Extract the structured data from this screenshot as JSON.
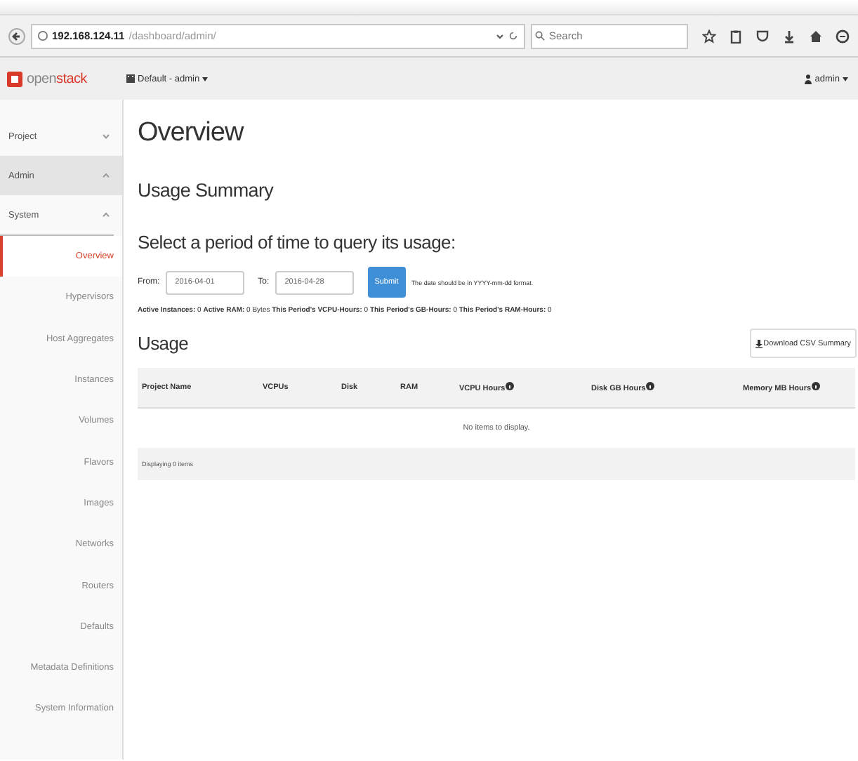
{
  "browser": {
    "url_host": "192.168.124.11",
    "url_path": "/dashboard/admin/",
    "search": {
      "placeholder": "Search"
    }
  },
  "header": {
    "logo_left": "open",
    "logo_right": "stack",
    "project_menu": "Default - admin",
    "user_menu": "admin"
  },
  "sidebar": {
    "dashboards": [
      {
        "label": "Project",
        "expanded": false
      },
      {
        "label": "Admin",
        "expanded": true,
        "children": [
          {
            "label": "System",
            "expanded": true,
            "children": [
              {
                "label": "Overview",
                "selected": true
              },
              {
                "label": "Hypervisors",
                "selected": false
              },
              {
                "label": "Host Aggregates",
                "selected": false
              },
              {
                "label": "Instances",
                "selected": false
              },
              {
                "label": "Volumes",
                "selected": false
              },
              {
                "label": "Flavors",
                "selected": false
              },
              {
                "label": "Images",
                "selected": false
              },
              {
                "label": "Networks",
                "selected": false
              },
              {
                "label": "Routers",
                "selected": false
              },
              {
                "label": "Defaults",
                "selected": false
              },
              {
                "label": "Metadata Definitions",
                "selected": false
              },
              {
                "label": "System Information",
                "selected": false
              }
            ]
          }
        ]
      }
    ]
  },
  "page": {
    "title": "Overview",
    "section_title": "Usage Summary",
    "period_prompt": "Select a period of time to query its usage:",
    "form": {
      "from_label": "From:",
      "from_value": "2016-04-01",
      "to_label": "To:",
      "to_value": "2016-04-28",
      "submit": "Submit",
      "help": "The date should be in YYYY-mm-dd format."
    },
    "stats": "**Active Instances:** 0 **Active RAM:** 0 Bytes **This Period's VCPU-Hours:** 0 **This Period's GB-Hours:** 0 **This Period's RAM-Hours:** 0",
    "usage": {
      "title": "Usage",
      "download": "Download CSV Summary",
      "columns": [
        {
          "label": "Project Name",
          "help": false
        },
        {
          "label": "VCPUs",
          "help": false
        },
        {
          "label": "Disk",
          "help": false
        },
        {
          "label": "RAM",
          "help": false
        },
        {
          "label": "VCPU Hours",
          "help": true
        },
        {
          "label": "Disk GB Hours",
          "help": true
        },
        {
          "label": "Memory MB Hours",
          "help": true
        }
      ],
      "empty": "No items to display.",
      "footer": "Displaying 0 items"
    }
  }
}
